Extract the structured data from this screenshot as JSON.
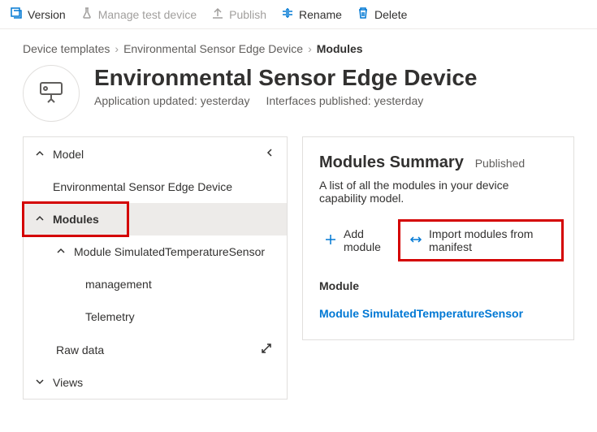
{
  "toolbar": {
    "version": "Version",
    "manage_test": "Manage test device",
    "publish": "Publish",
    "rename": "Rename",
    "delete": "Delete"
  },
  "breadcrumb": {
    "root": "Device templates",
    "parent": "Environmental Sensor Edge Device",
    "current": "Modules"
  },
  "header": {
    "title": "Environmental Sensor Edge Device",
    "app_updated": "Application updated: yesterday",
    "iface_pub": "Interfaces published: yesterday"
  },
  "sidebar": {
    "model": "Model",
    "model_child": "Environmental Sensor Edge Device",
    "modules": "Modules",
    "module_child": "Module SimulatedTemperatureSensor",
    "management": "management",
    "telemetry": "Telemetry",
    "raw_data": "Raw data",
    "views": "Views"
  },
  "panel": {
    "title": "Modules Summary",
    "status": "Published",
    "desc": "A list of all the modules in your device capability model.",
    "add": "Add module",
    "import": "Import modules from manifest",
    "module_heading": "Module",
    "module_link": "Module SimulatedTemperatureSensor"
  }
}
